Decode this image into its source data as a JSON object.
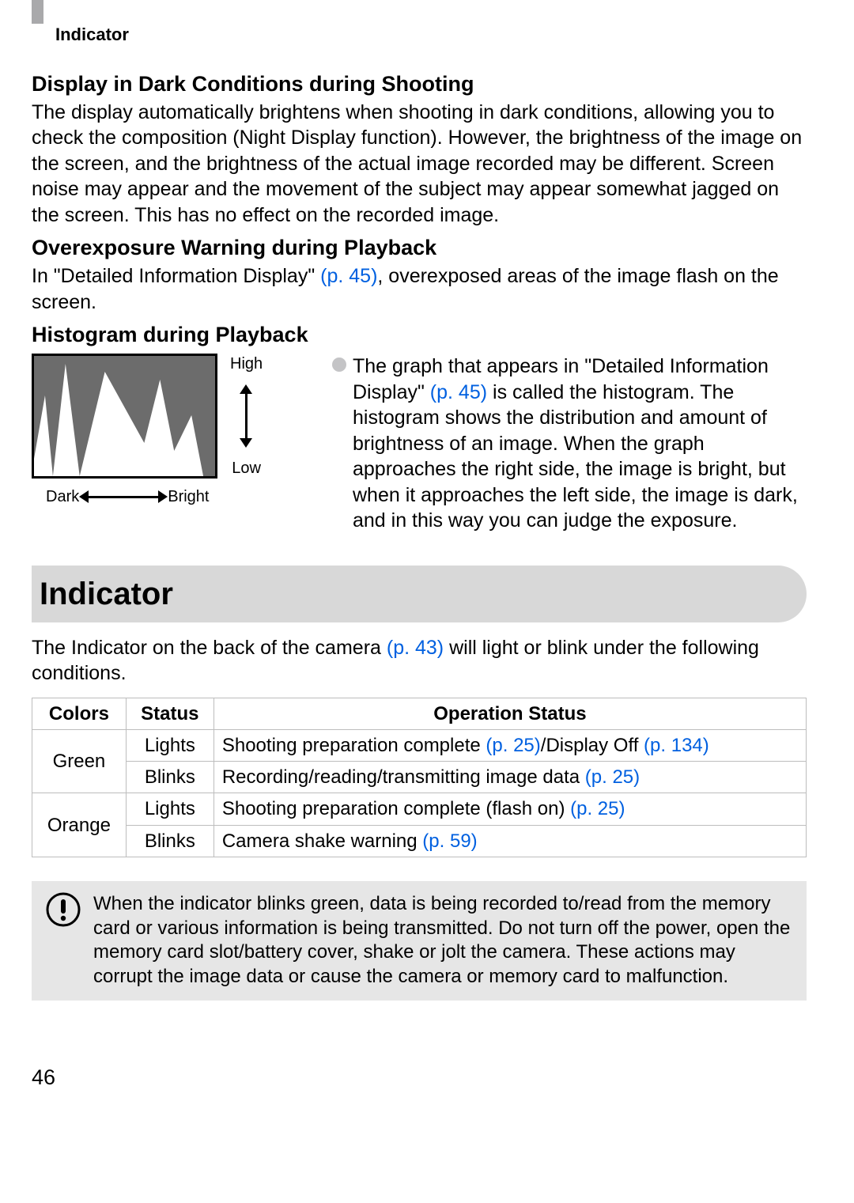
{
  "header": {
    "label": "Indicator"
  },
  "sectionA": {
    "title": "Display in Dark Conditions during Shooting",
    "body": "The display automatically brightens when shooting in dark conditions, allowing you to check the composition (Night Display function). However, the brightness of the image on the screen, and the brightness of the actual image recorded may be different. Screen noise may appear and the movement of the subject may appear somewhat jagged on the screen. This has no effect on the recorded image."
  },
  "sectionB": {
    "title": "Overexposure Warning during Playback",
    "body_pre": "In \"Detailed Information Display\" ",
    "link": "(p. 45)",
    "body_post": ", overexposed areas of the image flash on the screen."
  },
  "sectionC": {
    "title": "Histogram during Playback",
    "high": "High",
    "low": "Low",
    "dark": "Dark",
    "bright": "Bright",
    "body_pre": "The graph that appears in \"Detailed Information Display\" ",
    "link": "(p. 45)",
    "body_post": " is called the histogram. The histogram shows the distribution and amount of brightness of an image. When the graph approaches the right side, the image is bright, but when it approaches the left side, the image is dark, and in this way you can judge the exposure."
  },
  "indicator": {
    "title": "Indicator",
    "intro_pre": "The Indicator on the back of the camera ",
    "intro_link": "(p. 43)",
    "intro_post": " will light or blink under the following conditions.",
    "headers": {
      "colors": "Colors",
      "status": "Status",
      "op": "Operation Status"
    },
    "rows": [
      {
        "color": "Green",
        "status": "Lights",
        "op_pre": "Shooting preparation complete ",
        "op_link1": "(p. 25)",
        "op_mid": "/Display Off ",
        "op_link2": "(p. 134)",
        "op_post": ""
      },
      {
        "color": "",
        "status": "Blinks",
        "op_pre": "Recording/reading/transmitting image data ",
        "op_link1": "(p. 25)",
        "op_mid": "",
        "op_link2": "",
        "op_post": ""
      },
      {
        "color": "Orange",
        "status": "Lights",
        "op_pre": "Shooting preparation complete (flash on) ",
        "op_link1": "(p. 25)",
        "op_mid": "",
        "op_link2": "",
        "op_post": ""
      },
      {
        "color": "",
        "status": "Blinks",
        "op_pre": "Camera shake warning ",
        "op_link1": "(p. 59)",
        "op_mid": "",
        "op_link2": "",
        "op_post": ""
      }
    ]
  },
  "warning": {
    "text": "When the indicator blinks green, data is being recorded to/read from the memory card or various information is being transmitted. Do not turn off the power, open the memory card slot/battery cover, shake or jolt the camera. These actions may corrupt the image data or cause the camera or memory card to malfunction."
  },
  "page": "46"
}
